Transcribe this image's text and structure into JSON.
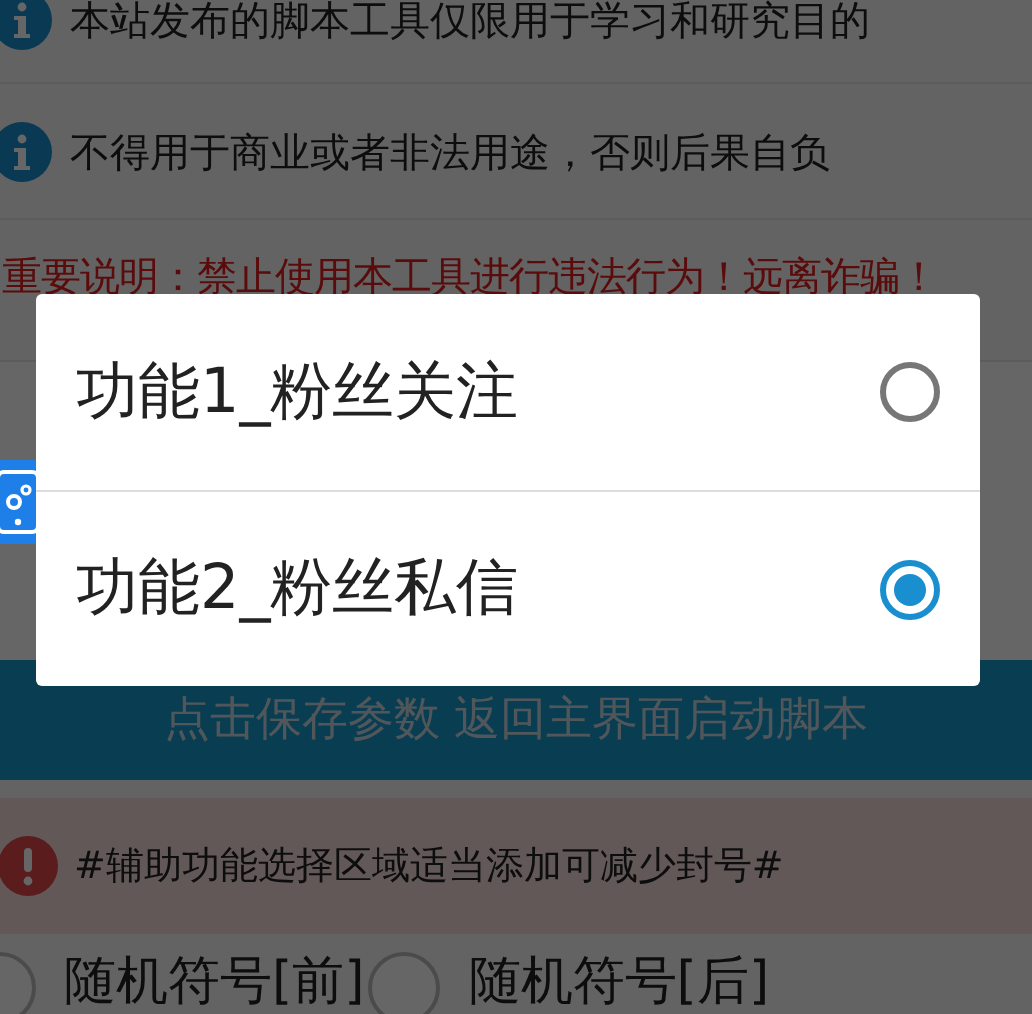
{
  "notices": [
    {
      "kind": "info",
      "text": "本站发布的脚本工具仅限用于学习和研究目的"
    },
    {
      "kind": "info",
      "text": "不得用于商业或者非法用途，否则后果自负"
    }
  ],
  "warning_text": "重要说明：禁止使用本工具进行违法行为！远离诈骗！",
  "save_button": "点击保存参数 返回主界面启动脚本",
  "alert": {
    "kind": "error",
    "text": "#辅助功能选择区域适当添加可减少封号#"
  },
  "options": [
    {
      "label": "随机符号[前]",
      "checked": false
    },
    {
      "label": "随机符号[后]",
      "checked": false
    }
  ],
  "dialog": {
    "items": [
      {
        "label": "功能1_粉丝关注",
        "selected": false
      },
      {
        "label": "功能2_粉丝私信",
        "selected": true
      }
    ]
  }
}
